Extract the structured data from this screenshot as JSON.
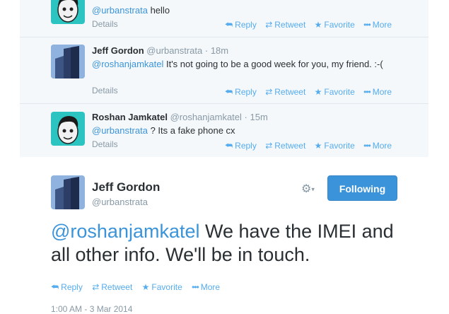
{
  "conversation": [
    {
      "name": "",
      "handle": "",
      "time": "",
      "mention": "@urbanstrata",
      "text": " hello",
      "details": "Details",
      "avatar": "roshan"
    },
    {
      "name": "Jeff Gordon",
      "handle": "@urbanstrata",
      "time": "· 18m",
      "mention": "@roshanjamkatel",
      "text": " It's not going to be a good week for you, my friend. :-(",
      "details": "Details",
      "avatar": "building"
    },
    {
      "name": "Roshan Jamkatel",
      "handle": "@roshanjamkatel",
      "time": "· 15m",
      "mention": "@urbanstrata",
      "text": " ? Its a fake phone cx",
      "details": "Details",
      "avatar": "roshan"
    }
  ],
  "actions": {
    "reply": "Reply",
    "retweet": "Retweet",
    "favorite": "Favorite",
    "more": "More"
  },
  "icons": {
    "reply": "reply-arrow-icon",
    "retweet": "retweet-icon",
    "favorite": "star-icon",
    "more": "more-dots-icon",
    "gear": "gear-icon"
  },
  "main_tweet": {
    "name": "Jeff Gordon",
    "handle": "@urbanstrata",
    "follow_label": "Following",
    "mention": "@roshanjamkatel",
    "text": " We have the IMEI and all other info. We'll be in touch.",
    "timestamp": "1:00 AM - 3 Mar 2014"
  },
  "colors": {
    "link": "#3b94d9",
    "button": "#3b94d9",
    "muted": "#8899a6",
    "conversation_bg": "#f5f8fa"
  }
}
